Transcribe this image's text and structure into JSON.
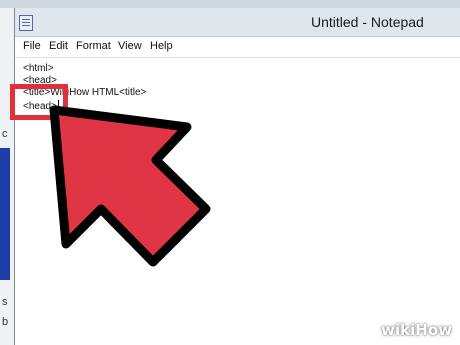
{
  "window": {
    "title": "Untitled - Notepad"
  },
  "menu": {
    "items": [
      "File",
      "Edit",
      "Format",
      "View",
      "Help"
    ]
  },
  "editor": {
    "lines": [
      "<html>",
      "<head>",
      "<title>WikiHow HTML<title>",
      "<head>"
    ]
  },
  "background_window": {
    "chars": [
      "c",
      "s",
      "b"
    ]
  },
  "colors": {
    "highlight": "#e0303e",
    "arrow_fill": "#e03545",
    "arrow_stroke": "#000000"
  },
  "icons": {
    "app": "notepad-icon",
    "pointer": "arrow-cursor-icon"
  },
  "watermark": {
    "text": "wikiHow"
  }
}
